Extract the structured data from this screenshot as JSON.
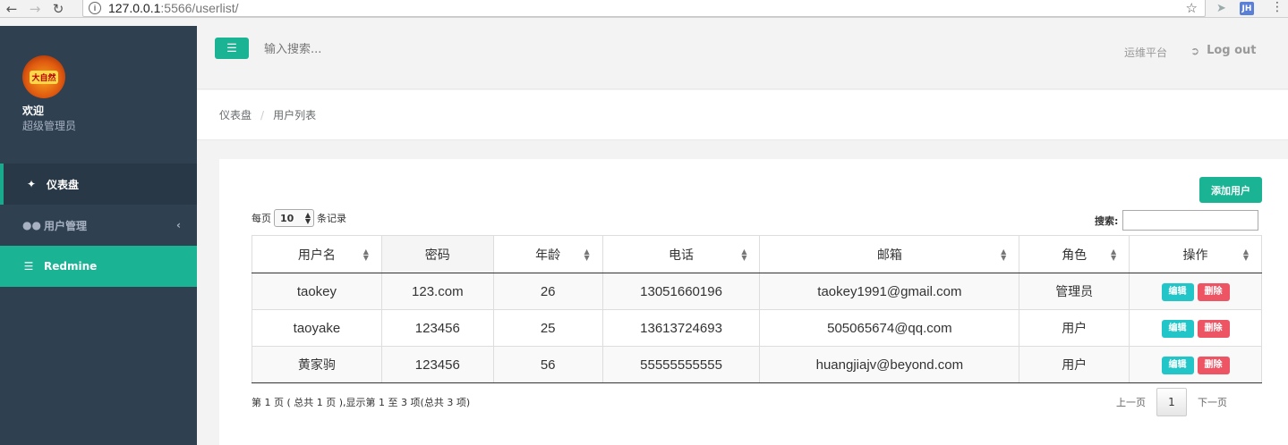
{
  "browser": {
    "url_host": "127.0.0.1",
    "url_path": ":5566/userlist/",
    "ext_label": "JH"
  },
  "sidebar": {
    "avatar_text": "大自然",
    "welcome": "欢迎",
    "role": "超级管理员",
    "items": [
      {
        "label": "仪表盘",
        "icon": "gitlab-fox-icon"
      },
      {
        "label": "用户管理",
        "icon": "users-icon"
      },
      {
        "label": "Redmine",
        "icon": "database-icon"
      }
    ]
  },
  "topbar": {
    "search_placeholder": "输入搜索...",
    "ops_platform": "运维平台",
    "logout": "Log out"
  },
  "breadcrumb": {
    "home": "仪表盘",
    "sep": "/",
    "current": "用户列表"
  },
  "table_controls": {
    "add_user": "添加用户",
    "per_page_prefix": "每页",
    "per_page_value": "10",
    "per_page_suffix": "条记录",
    "search_label": "搜索:"
  },
  "table": {
    "headers": [
      "用户名",
      "密码",
      "年龄",
      "电话",
      "邮箱",
      "角色",
      "操作"
    ],
    "rows": [
      {
        "username": "taokey",
        "password": "123.com",
        "age": "26",
        "phone": "13051660196",
        "email": "taokey1991@gmail.com",
        "role": "管理员"
      },
      {
        "username": "taoyake",
        "password": "123456",
        "age": "25",
        "phone": "13613724693",
        "email": "505065674@qq.com",
        "role": "用户"
      },
      {
        "username": "黄家驹",
        "password": "123456",
        "age": "56",
        "phone": "55555555555",
        "email": "huangjiajv@beyond.com",
        "role": "用户"
      }
    ],
    "edit_label": "编辑",
    "delete_label": "删除"
  },
  "footer": {
    "info": "第 1 页 ( 总共 1 页 ),显示第 1 至 3 项(总共 3 项)",
    "prev": "上一页",
    "current_page": "1",
    "next": "下一页"
  },
  "colors": {
    "sidebar_bg": "#2f4050",
    "accent": "#1ab394",
    "edit": "#23c6c8",
    "delete": "#ed5565"
  }
}
